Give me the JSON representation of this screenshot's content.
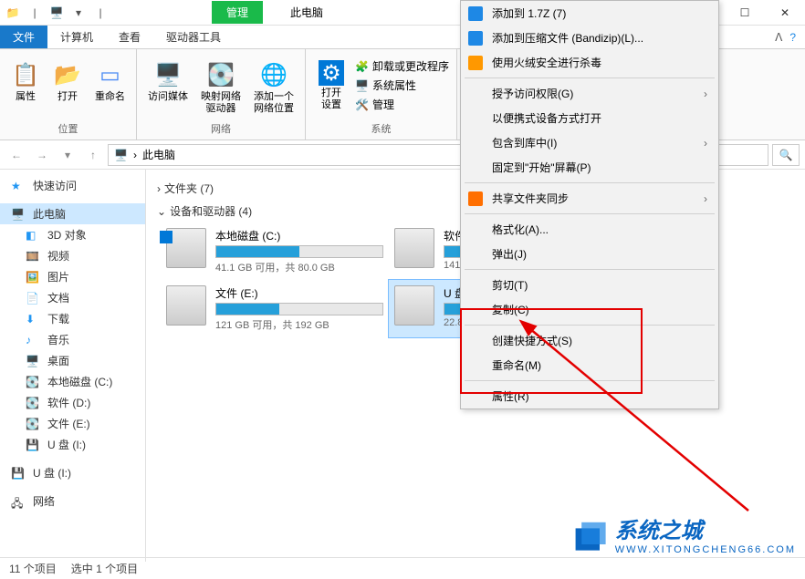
{
  "titlebar": {
    "manage_tab": "管理",
    "title": "此电脑"
  },
  "menubar": {
    "file": "文件",
    "computer": "计算机",
    "view": "查看",
    "drive_tools": "驱动器工具"
  },
  "ribbon": {
    "g1": {
      "label": "位置",
      "props": "属性",
      "open": "打开",
      "rename": "重命名"
    },
    "g2": {
      "label": "网络",
      "media": "访问媒体",
      "map": "映射网络\n驱动器",
      "addloc": "添加一个\n网络位置"
    },
    "g3": {
      "label": "系统",
      "settings": "打开\n设置",
      "uninstall": "卸载或更改程序",
      "sysprops": "系统属性",
      "manage": "管理"
    }
  },
  "address": "此电脑",
  "sidebar": {
    "quick": "快速访问",
    "thispc": "此电脑",
    "obj3d": "3D 对象",
    "video": "视频",
    "pictures": "图片",
    "docs": "文档",
    "downloads": "下载",
    "music": "音乐",
    "desktop": "桌面",
    "localc": "本地磁盘 (C:)",
    "softd": "软件 (D:)",
    "filee": "文件 (E:)",
    "udisk1": "U 盘 (I:)",
    "udisk2": "U 盘 (I:)",
    "network": "网络"
  },
  "main": {
    "folders_hdr": "文件夹 (7)",
    "devices_hdr": "设备和驱动器 (4)",
    "drives": [
      {
        "name": "本地磁盘 (C:)",
        "stat": "41.1 GB 可用，共 80.0 GB",
        "fill": 50,
        "win": true
      },
      {
        "name": "软件",
        "stat": "141",
        "fill": 40
      },
      {
        "name": "文件 (E:)",
        "stat": "121 GB 可用，共 192 GB",
        "fill": 38
      },
      {
        "name": "U 盘",
        "stat": "22.8",
        "fill": 30,
        "sel": true
      }
    ]
  },
  "ctx": [
    {
      "t": "添加到 1.7Z (7)",
      "ic": "#1e88e5"
    },
    {
      "t": "添加到压缩文件 (Bandizip)(L)...",
      "ic": "#1e88e5"
    },
    {
      "t": "使用火绒安全进行杀毒",
      "ic": "#ff9800"
    },
    {
      "sep": true
    },
    {
      "t": "授予访问权限(G)",
      "arrow": true
    },
    {
      "t": "以便携式设备方式打开"
    },
    {
      "t": "包含到库中(I)",
      "arrow": true
    },
    {
      "t": "固定到\"开始\"屏幕(P)"
    },
    {
      "sep": true
    },
    {
      "t": "共享文件夹同步",
      "ic": "#ff6f00",
      "arrow": true
    },
    {
      "sep": true
    },
    {
      "t": "格式化(A)..."
    },
    {
      "t": "弹出(J)"
    },
    {
      "sep": true
    },
    {
      "t": "剪切(T)"
    },
    {
      "t": "复制(C)"
    },
    {
      "sep": true
    },
    {
      "t": "创建快捷方式(S)"
    },
    {
      "t": "重命名(M)"
    },
    {
      "sep": true
    },
    {
      "t": "属性(R)"
    }
  ],
  "status": {
    "items": "11 个项目",
    "selected": "选中 1 个项目"
  },
  "watermark": {
    "t1": "系统之城",
    "t2": "WWW.XITONGCHENG66.COM"
  }
}
